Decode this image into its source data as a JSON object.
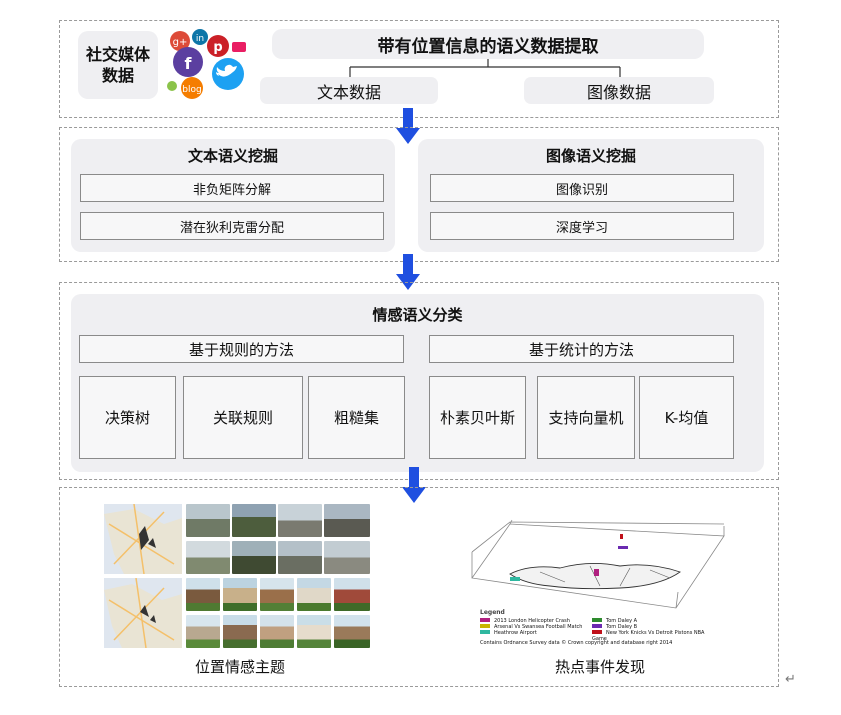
{
  "colors": {
    "arrow": "#1f4fe0",
    "panel": "#efeff2",
    "border": "#9a9a9a"
  },
  "section1": {
    "source_label": "社交媒体\n数据",
    "main_title": "带有位置信息的语义数据提取",
    "text_data": "文本数据",
    "image_data": "图像数据",
    "icons": [
      "google-plus-icon",
      "linkedin-icon",
      "pinterest-icon",
      "facebook-icon",
      "twitter-icon",
      "blogger-icon"
    ]
  },
  "section2": {
    "text_panel": {
      "title": "文本语义挖掘",
      "items": [
        "非负矩阵分解",
        "潜在狄利克雷分配"
      ]
    },
    "image_panel": {
      "title": "图像语义挖掘",
      "items": [
        "图像识别",
        "深度学习"
      ]
    }
  },
  "section3": {
    "title": "情感语义分类",
    "rule_group": {
      "label": "基于规则的方法",
      "items": [
        "决策树",
        "关联规则",
        "粗糙集"
      ]
    },
    "stat_group": {
      "label": "基于统计的方法",
      "items": [
        "朴素贝叶斯",
        "支持向量机",
        "K-均值"
      ]
    }
  },
  "section4": {
    "left_caption": "位置情感主题",
    "right_caption": "热点事件发现",
    "legend_title": "Legend",
    "legend_left": [
      "2013 London Helicopter Crash",
      "Arsenal Vs Swansea Football Match",
      "Heathrow Airport"
    ],
    "legend_right": [
      "Tom Daley A",
      "Tom Daley B",
      "New York Knicks Vs Detroit Pistons NBA Game"
    ],
    "legend_colors": [
      "#b0207f",
      "#c8b400",
      "#2fb8a0",
      "#2e8b2e",
      "#6a2ab0",
      "#c0101a"
    ],
    "copyright": "Contains Ordnance Survey data © Crown copyright and database right 2014"
  }
}
